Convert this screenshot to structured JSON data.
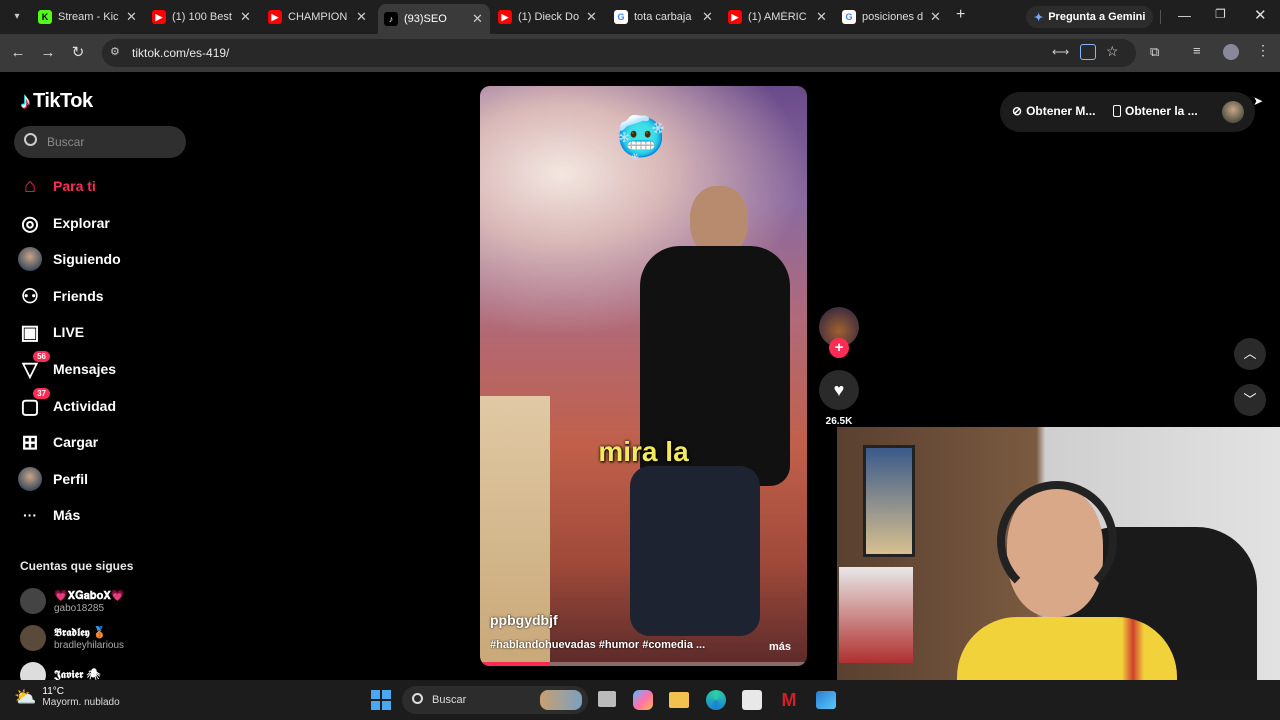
{
  "browser": {
    "tabs": [
      {
        "title": "Stream - Kic",
        "fav_color": "#53fc18",
        "fav_text": "K"
      },
      {
        "title": "(1) 100 Best",
        "fav_color": "#ff0000",
        "fav_text": "▶"
      },
      {
        "title": "CHAMPION",
        "fav_color": "#ff0000",
        "fav_text": "▶"
      },
      {
        "title": "(93)SEO",
        "fav_color": "#000000",
        "fav_text": "♪",
        "active": true
      },
      {
        "title": "(1) Dieck Do",
        "fav_color": "#ff0000",
        "fav_text": "▶"
      },
      {
        "title": "tota carbaja",
        "fav_color": "#ffffff",
        "fav_text": "G"
      },
      {
        "title": "(1) AMÉRIC",
        "fav_color": "#ff0000",
        "fav_text": "▶"
      },
      {
        "title": "posiciones d",
        "fav_color": "#ffffff",
        "fav_text": "G"
      }
    ],
    "new_tab": "+",
    "gemini": "Pregunta a Gemini",
    "url": "tiktok.com/es-419/"
  },
  "tiktok": {
    "logo": "TikTok",
    "search_placeholder": "Buscar",
    "nav": [
      {
        "label": "Para ti",
        "icon": "home-icon",
        "active": true
      },
      {
        "label": "Explorar",
        "icon": "compass-icon"
      },
      {
        "label": "Siguiendo",
        "icon": "following-avatar-icon"
      },
      {
        "label": "Friends",
        "icon": "friends-icon"
      },
      {
        "label": "LIVE",
        "icon": "live-icon"
      },
      {
        "label": "Mensajes",
        "icon": "messages-icon",
        "badge": "56"
      },
      {
        "label": "Actividad",
        "icon": "activity-icon",
        "badge": "37"
      },
      {
        "label": "Cargar",
        "icon": "upload-icon"
      },
      {
        "label": "Perfil",
        "icon": "profile-avatar-icon"
      },
      {
        "label": "Más",
        "icon": "more-icon"
      }
    ],
    "following_title": "Cuentas que sigues",
    "following": [
      {
        "name": "💗𝐗𝐆𝐚𝐛𝐨𝐗💗",
        "handle": "gabo18285"
      },
      {
        "name": "𝕭𝖗𝖆𝖉𝖑𝖊𝖞 🥉",
        "handle": "bradleyhilarious"
      },
      {
        "name": "𝕵𝖆𝖛𝖎𝖊𝖗 🕷",
        "handle": ""
      }
    ],
    "top_right": {
      "coins": "Obtener M...",
      "app": "Obtener la ..."
    },
    "video": {
      "caption": "mira la",
      "emoji": "🥶",
      "author": "ppbgydbjf",
      "description": "#hablandohuevadas #humor #comedia ...",
      "more": "más",
      "likes": "26.5K"
    }
  },
  "taskbar": {
    "weather_temp": "11°C",
    "weather_desc": "Mayorm. nublado",
    "search": "Buscar"
  }
}
